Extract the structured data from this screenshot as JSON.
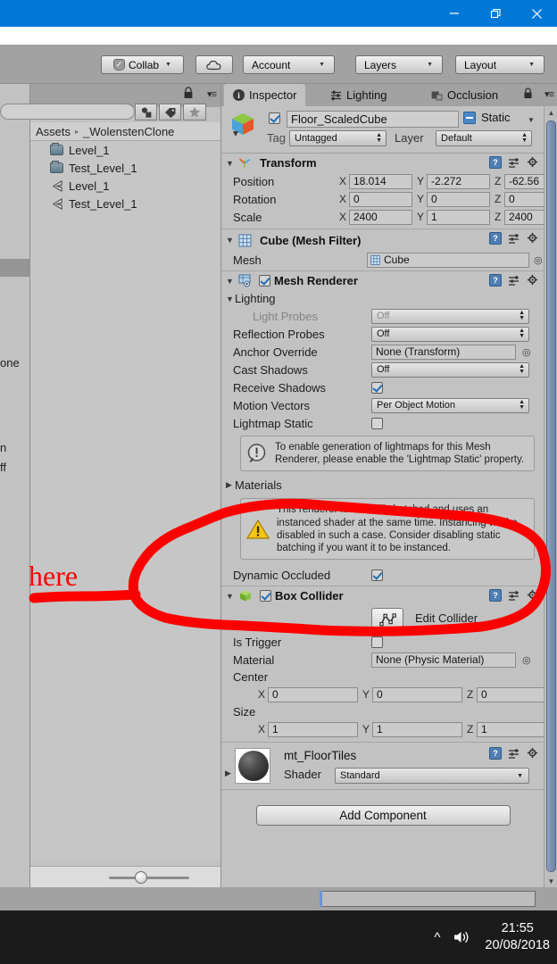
{
  "window": {
    "minimize_label": "minimize-icon",
    "restore_label": "restore-icon",
    "close_label": "close-icon",
    "titlebar_color": "#0078d7"
  },
  "toolbar": {
    "collab": "Collab",
    "cloud": "cloud-icon",
    "account": "Account",
    "layers": "Layers",
    "layout": "Layout"
  },
  "scene_sliver": {
    "clip_line1": "one",
    "clip_line2": "n",
    "clip_line3": "ff"
  },
  "project": {
    "search_value": "",
    "breadcrumb_root": "Assets",
    "breadcrumb_sep": "▸",
    "breadcrumb_current": "_WolenstenClone",
    "items": [
      {
        "label": "Level_1",
        "icon": "folder-icon"
      },
      {
        "label": "Test_Level_1",
        "icon": "folder-icon"
      },
      {
        "label": "Level_1",
        "icon": "unity-scene-icon"
      },
      {
        "label": "Test_Level_1",
        "icon": "unity-scene-icon"
      }
    ]
  },
  "inspector": {
    "tabs": [
      {
        "label": "Inspector",
        "icon": "info-icon",
        "active": true
      },
      {
        "label": "Lighting",
        "icon": "sliders-icon",
        "active": false
      },
      {
        "label": "Occlusion",
        "icon": "occlusion-icon",
        "active": false
      }
    ],
    "object": {
      "enabled": true,
      "name": "Floor_ScaledCube",
      "static_label": "Static",
      "tag_label": "Tag",
      "tag_value": "Untagged",
      "layer_label": "Layer",
      "layer_value": "Default"
    },
    "transform": {
      "title": "Transform",
      "rows": [
        {
          "label": "Position",
          "x": "18.014",
          "y": "-2.272",
          "z": "-62.56"
        },
        {
          "label": "Rotation",
          "x": "0",
          "y": "0",
          "z": "0"
        },
        {
          "label": "Scale",
          "x": "2400",
          "y": "1",
          "z": "2400"
        }
      ],
      "axis_x": "X",
      "axis_y": "Y",
      "axis_z": "Z"
    },
    "mesh_filter": {
      "title": "Cube (Mesh Filter)",
      "mesh_label": "Mesh",
      "mesh_value": "Cube"
    },
    "mesh_renderer": {
      "title": "Mesh Renderer",
      "enabled": true,
      "lighting_label": "Lighting",
      "light_probes_label": "Light Probes",
      "light_probes_value": "Off",
      "reflection_probes_label": "Reflection Probes",
      "reflection_probes_value": "Off",
      "anchor_override_label": "Anchor Override",
      "anchor_override_value": "None (Transform)",
      "cast_shadows_label": "Cast Shadows",
      "cast_shadows_value": "Off",
      "receive_shadows_label": "Receive Shadows",
      "receive_shadows_value": true,
      "motion_vectors_label": "Motion Vectors",
      "motion_vectors_value": "Per Object Motion",
      "lightmap_static_label": "Lightmap Static",
      "lightmap_static_value": false,
      "lightmap_help": "To enable generation of lightmaps for this Mesh Renderer, please enable the 'Lightmap Static' property.",
      "materials_label": "Materials",
      "instancing_warning": "This renderer is statically batched and uses an instanced shader at the same time. Instancing will be disabled in such a case. Consider disabling static batching if you want it to be instanced.",
      "dynamic_occluded_label": "Dynamic Occluded",
      "dynamic_occluded_value": true
    },
    "box_collider": {
      "title": "Box Collider",
      "enabled": true,
      "edit_collider_label": "Edit Collider",
      "is_trigger_label": "Is Trigger",
      "is_trigger_value": false,
      "material_label": "Material",
      "material_value": "None (Physic Material)",
      "center_label": "Center",
      "center": {
        "x": "0",
        "y": "0",
        "z": "0"
      },
      "size_label": "Size",
      "size": {
        "x": "1",
        "y": "1",
        "z": "1"
      }
    },
    "material": {
      "name": "mt_FloorTiles",
      "shader_label": "Shader",
      "shader_value": "Standard"
    },
    "add_component_label": "Add Component"
  },
  "annotation": {
    "text": "here",
    "color": "#ff0000"
  },
  "taskbar": {
    "time": "21:55",
    "date": "20/08/2018",
    "chevron": "show-hidden-icons",
    "speaker": "volume-icon"
  }
}
